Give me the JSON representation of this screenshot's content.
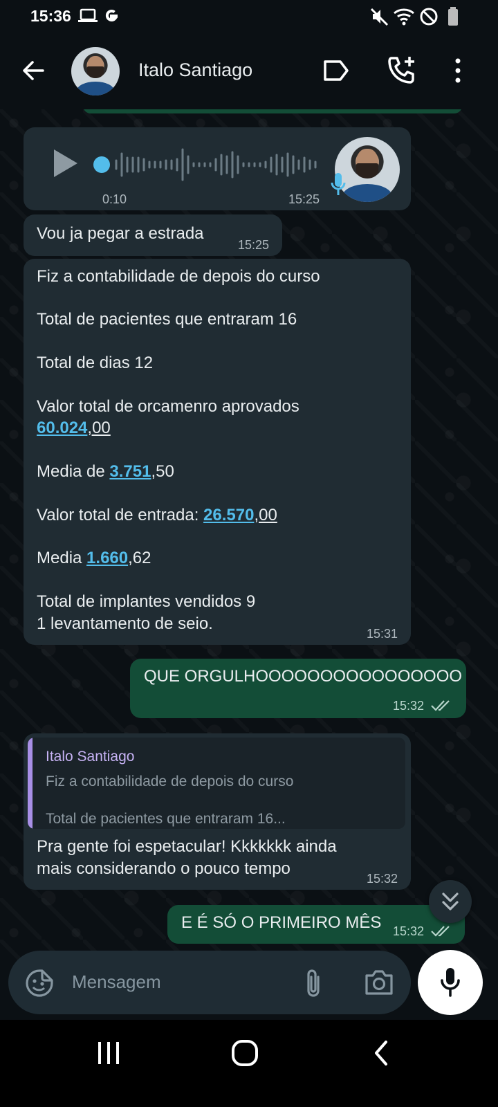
{
  "status_bar": {
    "time": "15:36",
    "left_icons": [
      "laptop-icon",
      "google-icon"
    ],
    "right_icons": [
      "mute-icon",
      "wifi-icon",
      "do-not-disturb-icon",
      "battery-icon"
    ]
  },
  "header": {
    "contact_name": "Italo Santiago",
    "icons": [
      "back-arrow-icon",
      "label-icon",
      "add-call-icon",
      "more-vert-icon"
    ]
  },
  "messages": {
    "voice": {
      "elapsed": "0:10",
      "time": "15:25"
    },
    "m1": {
      "text": "Vou ja pegar a estrada",
      "time": "15:25"
    },
    "m2": {
      "l1": "Fiz a contabilidade de depois do curso",
      "l2": "Total de pacientes que entraram 16",
      "l3": "Total de dias 12",
      "l4": "Valor total de orcamenro aprovados",
      "l5_link": "60.024",
      "l5_rest": ",00",
      "l6_pre": "Media de ",
      "l6_link": "3.751",
      "l6_rest": ",50",
      "l7_pre": "Valor total de entrada: ",
      "l7_link": "26.570",
      "l7_rest": ",00",
      "l8_pre": "Media ",
      "l8_link": "1.660",
      "l8_rest": ",62",
      "l9": "Total de implantes vendidos 9",
      "l10": "1 levantamento de seio.",
      "time": "15:31"
    },
    "m3": {
      "text": "QUE ORGULHOOOOOOOOOOOOOOOO",
      "time": "15:32"
    },
    "m4": {
      "quote_name": "Italo Santiago",
      "quote_line1": "Fiz a contabilidade de depois do curso",
      "quote_line2": "Total de pacientes que entraram 16...",
      "line1": "Pra gente foi espetacular! Kkkkkkk ainda",
      "line2": "mais considerando o pouco tempo",
      "time": "15:32"
    },
    "m5": {
      "text": "E É SÓ O PRIMEIRO MÊS",
      "time": "15:32"
    }
  },
  "input": {
    "placeholder": "Mensagem"
  },
  "colors": {
    "incoming_bubble": "#202c33",
    "outgoing_bubble": "#134d37",
    "link": "#53bdeb",
    "quote_accent": "#a88fe6",
    "voice_dot": "#53bdeb"
  }
}
